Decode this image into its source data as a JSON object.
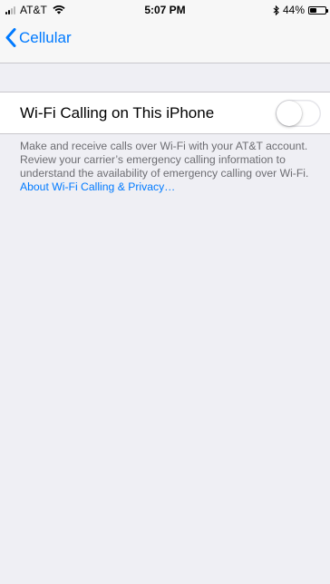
{
  "status_bar": {
    "carrier": "AT&T",
    "time": "5:07 PM",
    "battery_percent": "44%",
    "battery_level": 0.44,
    "icons": [
      "signal-icon",
      "wifi-icon",
      "bluetooth-icon",
      "battery-icon"
    ]
  },
  "nav": {
    "back_label": "Cellular",
    "back_icon": "chevron-left-icon"
  },
  "setting": {
    "label": "Wi-Fi Calling on This iPhone",
    "enabled": false
  },
  "footer": {
    "text": "Make and receive calls over Wi-Fi with your AT&T account. Review your carrier’s emergency calling information to understand the availability of emergency calling over Wi-Fi. ",
    "link": "About Wi-Fi Calling & Privacy…"
  },
  "colors": {
    "accent": "#007aff",
    "background": "#efeff4",
    "footer_text": "#6d6d72"
  }
}
